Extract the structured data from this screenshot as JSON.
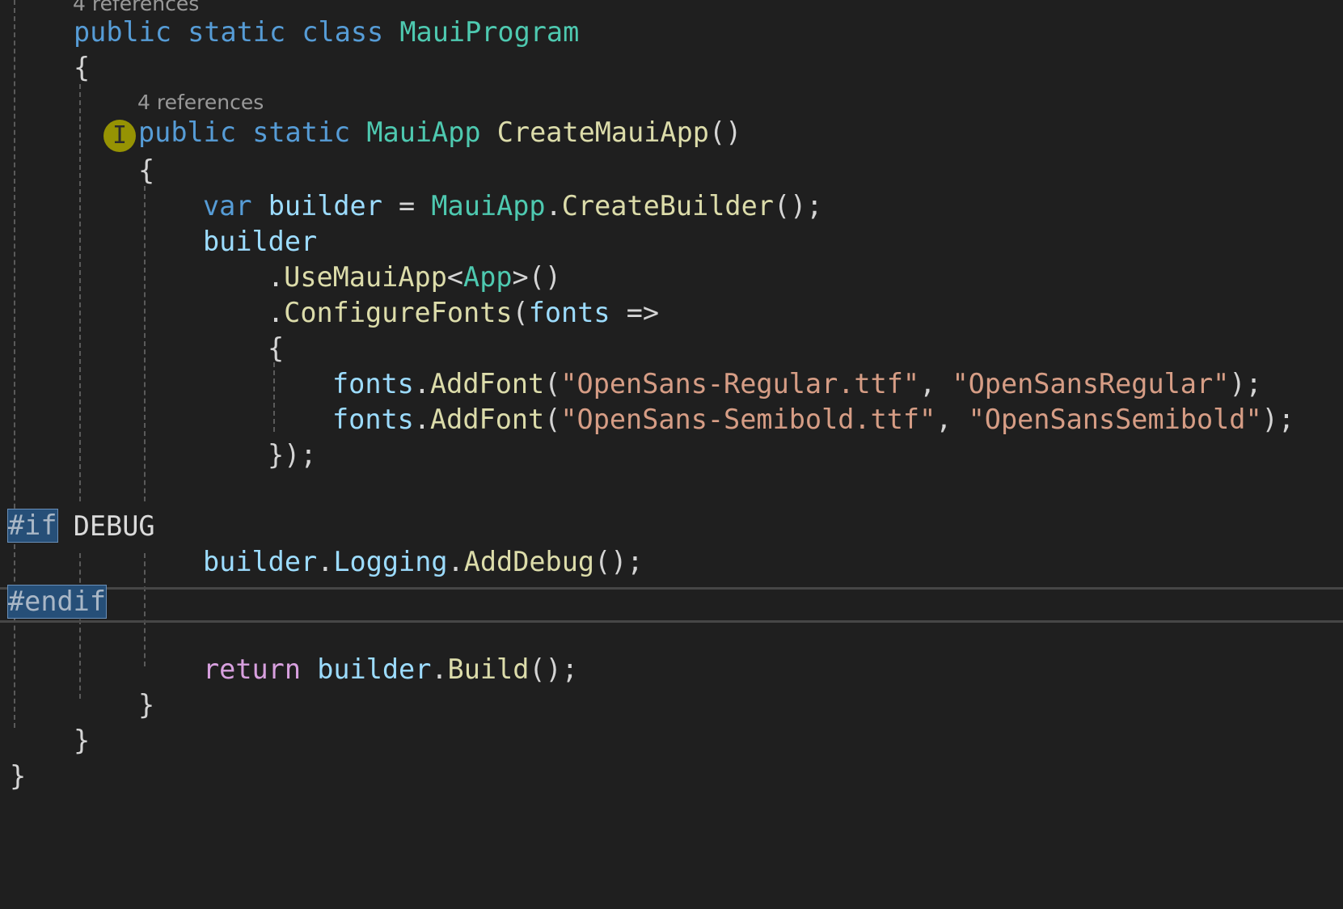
{
  "codelens": {
    "class_refs": "4 references",
    "method_refs": "4 references"
  },
  "code": {
    "l_class": {
      "public": "public",
      "static": "static",
      "class": "class",
      "name": "MauiProgram"
    },
    "l_open1": "{",
    "l_method": {
      "public": "public",
      "static": "static",
      "type": "MauiApp",
      "name": "CreateMauiApp",
      "parens": "()"
    },
    "l_open2": "{",
    "l_var": {
      "var": "var",
      "builder": "builder",
      "eq": " = ",
      "type": "MauiApp",
      "dot": ".",
      "fn": "CreateBuilder",
      "tail": "();"
    },
    "l_builder": "builder",
    "l_use": {
      "dot": ".",
      "fn": "UseMauiApp",
      "lt": "<",
      "type": "App",
      "gt": ">()"
    },
    "l_config": {
      "dot": ".",
      "fn": "ConfigureFonts",
      "paren": "(",
      "param": "fonts",
      "arrow": " =>"
    },
    "l_open3": "{",
    "l_font1": {
      "obj": "fonts",
      "dot": ".",
      "fn": "AddFont",
      "p1": "(",
      "s1": "\"OpenSans-Regular.ttf\"",
      "comma": ", ",
      "s2": "\"OpenSansRegular\"",
      "end": ");"
    },
    "l_font2": {
      "obj": "fonts",
      "dot": ".",
      "fn": "AddFont",
      "p1": "(",
      "s1": "\"OpenSans-Semibold.ttf\"",
      "comma": ", ",
      "s2": "\"OpenSansSemibold\"",
      "end": ");"
    },
    "l_close3": "});",
    "l_if": {
      "directive": "#if",
      "symbol": "DEBUG"
    },
    "l_log": {
      "obj": "builder",
      "dot1": ".",
      "prop": "Logging",
      "dot2": ".",
      "fn": "AddDebug",
      "end": "();"
    },
    "l_endif": {
      "directive": "#endif"
    },
    "l_return": {
      "kw": "return",
      "obj": "builder",
      "dot": ".",
      "fn": "Build",
      "end": "();"
    },
    "l_close2": "}",
    "l_close1": "}",
    "l_close0": "}"
  },
  "colors": {
    "background": "#1f1f1f",
    "keyword": "#569cd6",
    "control_keyword": "#d8a0df",
    "type": "#4ec9b0",
    "method": "#dcdcaa",
    "variable": "#9cdcfe",
    "string": "#d69d85",
    "directive_highlight": "#264f78"
  }
}
